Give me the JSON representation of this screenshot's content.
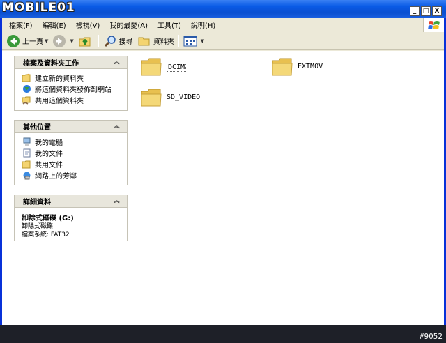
{
  "window": {
    "watermark_logo": "MOBILE01",
    "buttons": {
      "minimize": "_",
      "maximize": "□",
      "close": "X"
    }
  },
  "menu": [
    "檔案(F)",
    "編輯(E)",
    "檢視(V)",
    "我的最愛(A)",
    "工具(T)",
    "說明(H)"
  ],
  "toolbar": {
    "back": "上一頁",
    "search": "搜尋",
    "folders": "資料夾"
  },
  "sidebar": {
    "file_tasks": {
      "title": "檔案及資料夾工作",
      "items": [
        "建立新的資料夾",
        "將這個資料夾發佈到網站",
        "共用這個資料夾"
      ]
    },
    "other_places": {
      "title": "其他位置",
      "items": [
        "我的電腦",
        "我的文件",
        "共用文件",
        "網路上的芳鄰"
      ]
    },
    "details": {
      "title": "詳細資料",
      "name": "卸除式磁碟 (G:)",
      "type": "卸除式磁碟",
      "filesystem": "檔案系統: FAT32"
    }
  },
  "folders": [
    "DCIM",
    "EXTMOV",
    "SD_VIDEO"
  ],
  "watermark_id": "#9052",
  "colors": {
    "titlebar": "#0a5be6",
    "frame": "#0831d9",
    "folder": "#f4d470"
  }
}
